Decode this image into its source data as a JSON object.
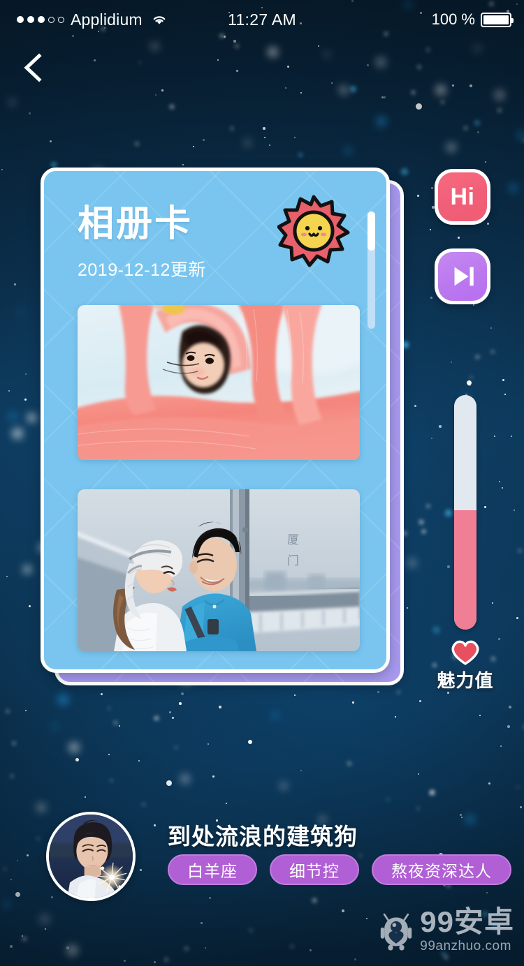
{
  "status_bar": {
    "carrier": "Applidium",
    "signal_dots_filled": 3,
    "signal_dots_total": 5,
    "wifi_icon": "wifi-icon",
    "time": "11:27 AM",
    "battery_percent": "100 %",
    "battery_level": 100
  },
  "nav": {
    "back_icon": "chevron-left-icon"
  },
  "card": {
    "title": "相册卡",
    "subtitle": "2019-12-12更新",
    "mascot_icon": "sun-face-icon",
    "background_color": "#79c5ef",
    "behind_card_color": "#a79af0",
    "scrollbar": {
      "thumb_position_percent": 0,
      "thumb_size_percent": 33
    },
    "photos": [
      {
        "name": "photo-girl-pink-fabric",
        "caption": ""
      },
      {
        "name": "photo-couple-bridge",
        "caption": "厦门"
      }
    ]
  },
  "side_buttons": [
    {
      "name": "hi-button",
      "label": "Hi",
      "color": "#f0617a",
      "icon": "text-label"
    },
    {
      "name": "next-button",
      "label": "",
      "color": "#bb78ee",
      "icon": "skip-next-icon"
    }
  ],
  "charm_gauge": {
    "label": "魅力值",
    "icon": "heart-icon",
    "fill_percent": 51,
    "fill_color": "#f07f95",
    "track_color": "#e2e8ef"
  },
  "profile": {
    "avatar_icon": "avatar-girl-sparkler",
    "username": "到处流浪的建筑狗",
    "tags": [
      "白羊座",
      "细节控",
      "熬夜资深达人"
    ],
    "tag_color": "#b05fd4"
  },
  "watermark": {
    "logo_icon": "robot-mascot-icon",
    "title": "99安卓",
    "url": "99anzhuo.com"
  }
}
